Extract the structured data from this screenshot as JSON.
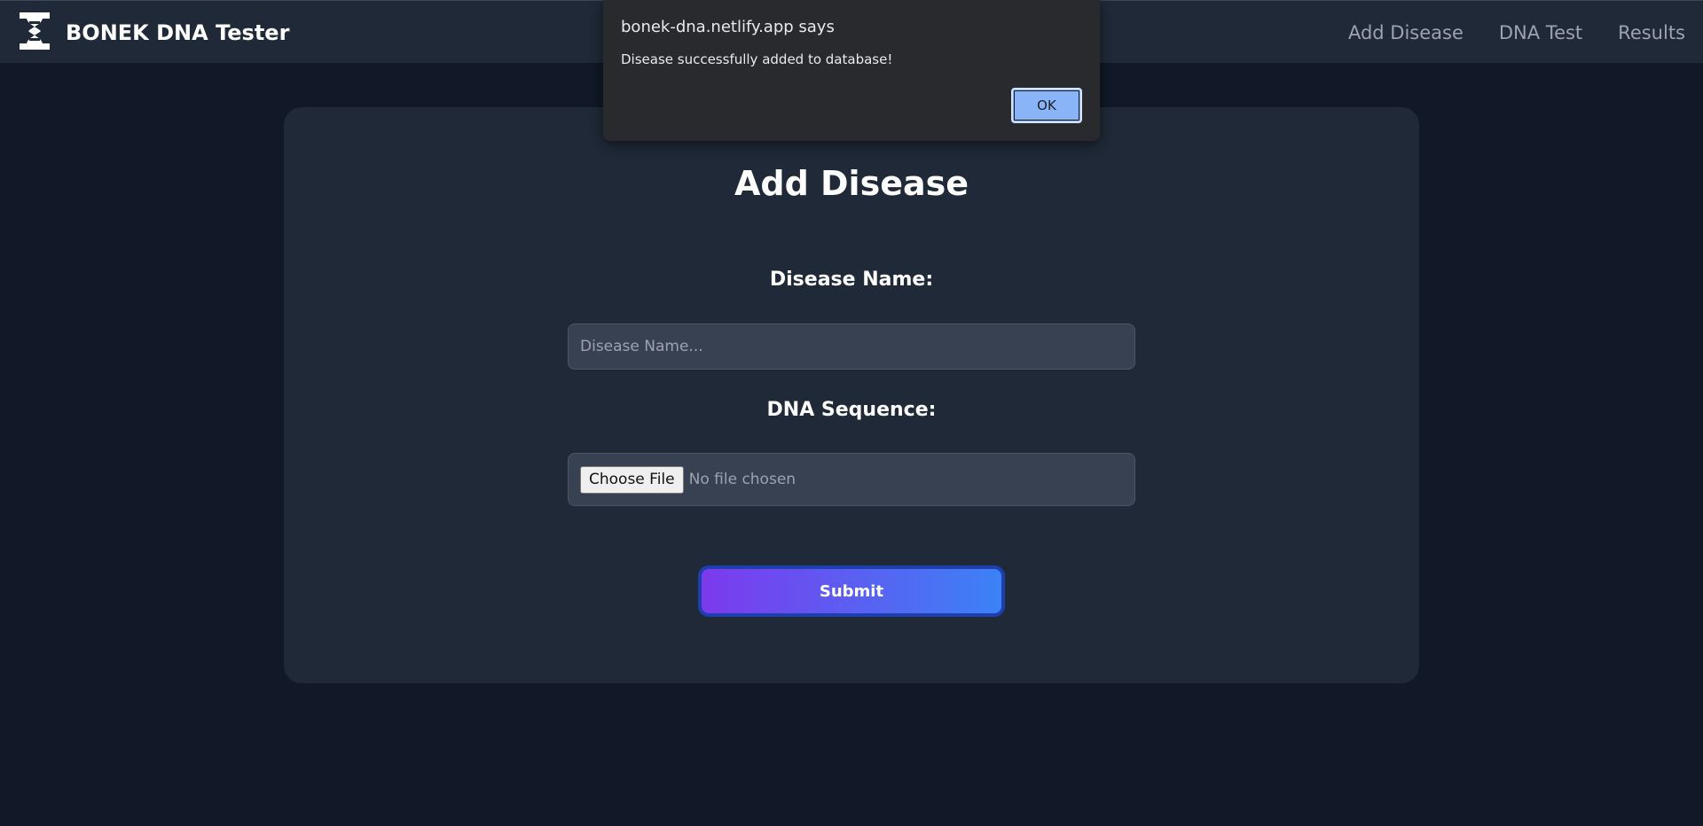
{
  "navbar": {
    "brand_name": "BONEK DNA Tester",
    "logo_icon": "dna-icon",
    "links": [
      "Add Disease",
      "DNA Test",
      "Results"
    ]
  },
  "form": {
    "title": "Add Disease",
    "disease_name_label": "Disease Name:",
    "disease_name_placeholder": "Disease Name...",
    "disease_name_value": "",
    "dna_sequence_label": "DNA Sequence:",
    "file_button_label": "Choose File",
    "file_status": "No file chosen",
    "submit_label": "Submit"
  },
  "dialog": {
    "title": "bonek-dna.netlify.app says",
    "message": "Disease successfully added to database!",
    "ok_label": "OK"
  },
  "colors": {
    "page_background": "#111827",
    "card_background": "#1f2937",
    "input_background": "#374151",
    "submit_gradient_start": "#7c3aed",
    "submit_gradient_end": "#3b82f6",
    "dialog_background": "#292a2d",
    "dialog_button": "#8ab4f8"
  }
}
